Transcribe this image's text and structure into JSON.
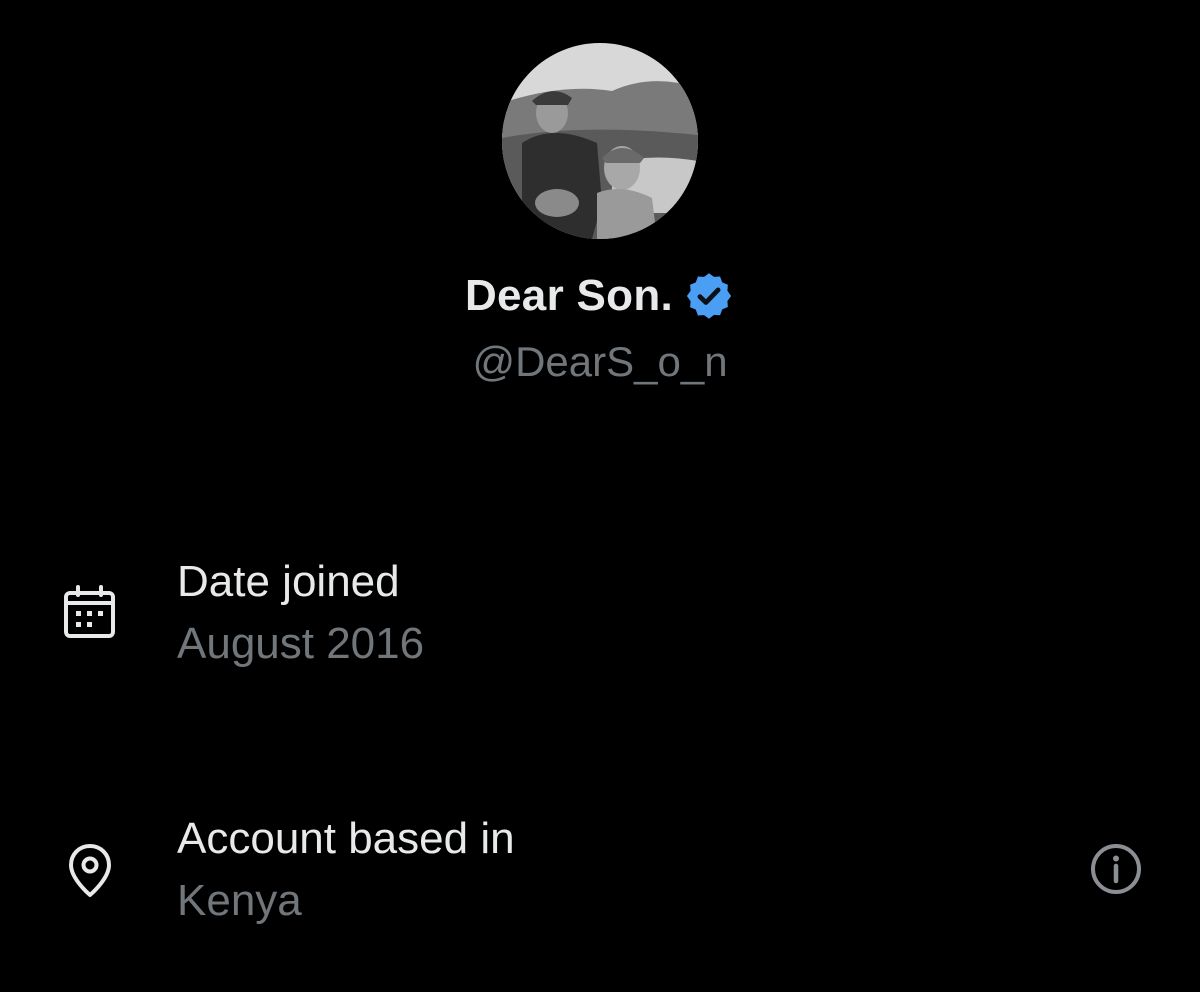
{
  "profile": {
    "display_name": "Dear Son.",
    "handle": "@DearS_o_n",
    "verified": true,
    "verified_color": "#4a9ff5",
    "avatar_description": "avatar"
  },
  "about": {
    "items": [
      {
        "icon": "calendar-icon",
        "label": "Date joined",
        "value": "August 2016"
      },
      {
        "icon": "location-pin-icon",
        "label": "Account based in",
        "value": "Kenya",
        "info_icon": "info-icon"
      }
    ]
  },
  "colors": {
    "background": "#000000",
    "primary_text": "#e7e9ea",
    "secondary_text": "#71767b"
  }
}
